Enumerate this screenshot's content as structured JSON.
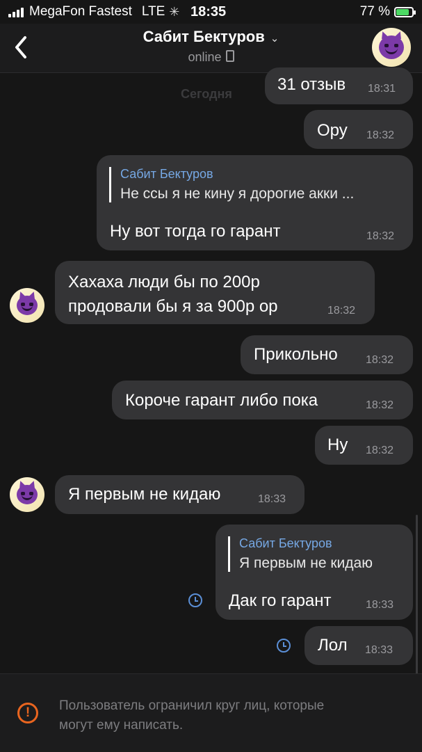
{
  "status_bar": {
    "carrier": "MegaFon Fastest",
    "network": "LTE",
    "time": "18:35",
    "battery": "77 %",
    "battery_level": 0.77
  },
  "header": {
    "contact_name": "Сабит Бектуров",
    "status": "online",
    "avatar": "smiling-devil-emoji"
  },
  "date_separator": "Сегодня",
  "messages": [
    {
      "dir": "out",
      "text": "31 отзыв",
      "time": "18:31"
    },
    {
      "dir": "out",
      "text": "Ору",
      "time": "18:32"
    },
    {
      "dir": "out",
      "reply_name": "Сабит Бектуров",
      "reply_text": "Не ссы я не кину я дорогие акки ...",
      "text": "Ну вот тогда го гарант",
      "time": "18:32"
    },
    {
      "dir": "in",
      "text_line1": "Хахаха люди бы по 200р",
      "text_line2": "продовали бы я за 900р ор",
      "time": "18:32"
    },
    {
      "dir": "out",
      "text": "Прикольно",
      "time": "18:32"
    },
    {
      "dir": "out",
      "text": "Короче гарант либо пока",
      "time": "18:32"
    },
    {
      "dir": "out",
      "text": "Ну",
      "time": "18:32"
    },
    {
      "dir": "in",
      "text": "Я первым не кидаю",
      "time": "18:33"
    },
    {
      "dir": "out",
      "reply_name": "Сабит Бектуров",
      "reply_text": "Я первым не кидаю",
      "text": "Дак го гарант",
      "time": "18:33",
      "pending": true
    },
    {
      "dir": "out",
      "text": "Лол",
      "time": "18:33",
      "pending": true
    }
  ],
  "restriction_notice": {
    "line1": "Пользователь ограничил круг лиц, которые",
    "line2": "могут ему написать.",
    "icon": "warning-icon"
  },
  "colors": {
    "background": "#161616",
    "bubble": "#343436",
    "accent_link": "#76a8e4",
    "pending_clock": "#5b8fd6",
    "warning": "#e9651f"
  }
}
